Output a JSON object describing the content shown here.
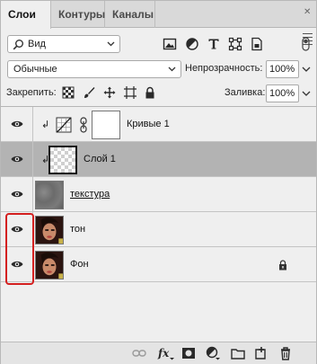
{
  "tabs": [
    {
      "label": "Слои"
    },
    {
      "label": "Контуры"
    },
    {
      "label": "Каналы"
    }
  ],
  "filter": {
    "kind_label": "Вид"
  },
  "blend": {
    "mode": "Обычные",
    "opacity_label": "Непрозрачность:",
    "opacity_value": "100%",
    "fill_label": "Заливка:",
    "fill_value": "100%"
  },
  "lock": {
    "label": "Закрепить:"
  },
  "layers": [
    {
      "name": "Кривые 1",
      "type": "adjustment",
      "visible": true,
      "clipped": true,
      "selected": false
    },
    {
      "name": "Слой 1",
      "type": "transparent",
      "visible": true,
      "clipped": true,
      "selected": true
    },
    {
      "name": "текстура",
      "type": "texture",
      "visible": true,
      "clipped": false,
      "selected": false
    },
    {
      "name": "тон",
      "type": "photo",
      "visible": true,
      "clipped": false,
      "selected": false
    },
    {
      "name": "Фон",
      "type": "photo",
      "visible": true,
      "clipped": false,
      "selected": false,
      "locked": true
    }
  ],
  "colors": {
    "highlight": "#d31f1f",
    "selected_row": "#b3b3b3",
    "panel": "#efefef"
  }
}
